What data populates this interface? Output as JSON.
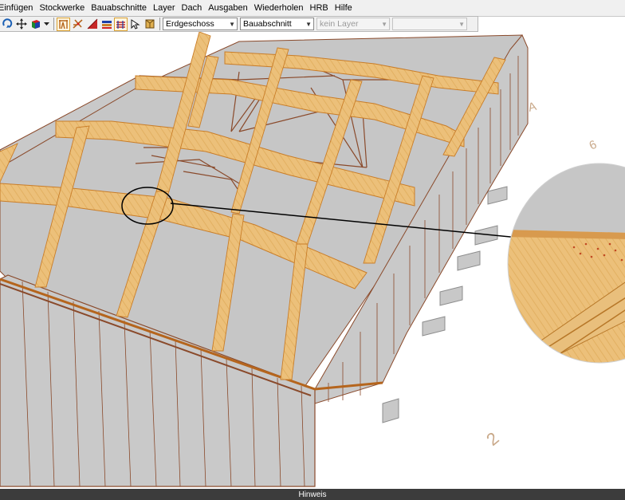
{
  "menu": {
    "items": [
      "Einfügen",
      "Stockwerke",
      "Bauabschnitte",
      "Layer",
      "Dach",
      "Ausgaben",
      "Wiederholen",
      "HRB",
      "Hilfe"
    ]
  },
  "toolbar": {
    "floor_select": "Erdgeschoss",
    "section_select": "Bauabschnitt",
    "layer_select": "kein Layer",
    "extra_select": ""
  },
  "viewport": {
    "axis_labels": {
      "a": "A",
      "six": "6",
      "two": "2"
    }
  },
  "status": {
    "hint": "Hinweis"
  }
}
